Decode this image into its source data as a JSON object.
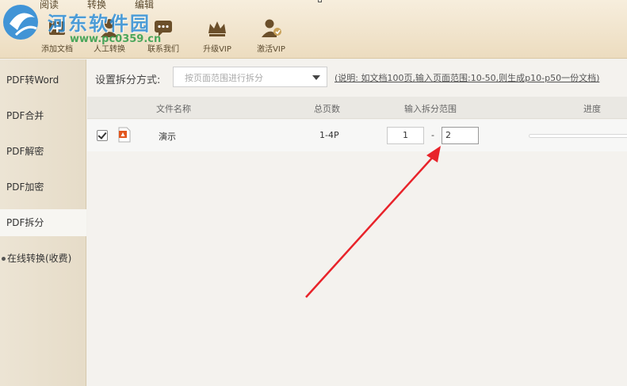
{
  "top_tabs": [
    "阅读",
    "转换",
    "编辑"
  ],
  "toolbar": {
    "buttons": [
      {
        "label": "添加文档",
        "icon": "add-document-icon"
      },
      {
        "label": "人工转换",
        "icon": "manual-convert-icon"
      },
      {
        "label": "联系我们",
        "icon": "contact-chat-icon"
      },
      {
        "label": "升级VIP",
        "icon": "crown-icon"
      },
      {
        "label": "激活VIP",
        "icon": "activate-vip-icon"
      }
    ]
  },
  "watermark": {
    "text": "河东软件园",
    "url": "www.pc0359.cn"
  },
  "sidebar": {
    "items": [
      {
        "label": "PDF转Word"
      },
      {
        "label": "PDF合并"
      },
      {
        "label": "PDF解密"
      },
      {
        "label": "PDF加密"
      },
      {
        "label": "PDF拆分",
        "active": true
      },
      {
        "label": "在线转换(收费)"
      }
    ]
  },
  "split": {
    "settings_label": "设置拆分方式:",
    "mode_value": "按页面范围进行拆分",
    "note": "(说明: 如文档100页,输入页面范围:10-50,则生成p10-p50一份文档)"
  },
  "table": {
    "headers": {
      "name": "文件名称",
      "pages": "总页数",
      "range": "输入拆分范围",
      "progress": "进度"
    },
    "rows": [
      {
        "name": "演示",
        "pages": "1-4P",
        "from": "1",
        "to": "2",
        "checked": true,
        "progress": 0
      }
    ]
  },
  "colors": {
    "accent_arrow": "#e8232a",
    "toolbar_bg": "#f0e3c9",
    "watermark_blue": "#2f8fd8"
  }
}
